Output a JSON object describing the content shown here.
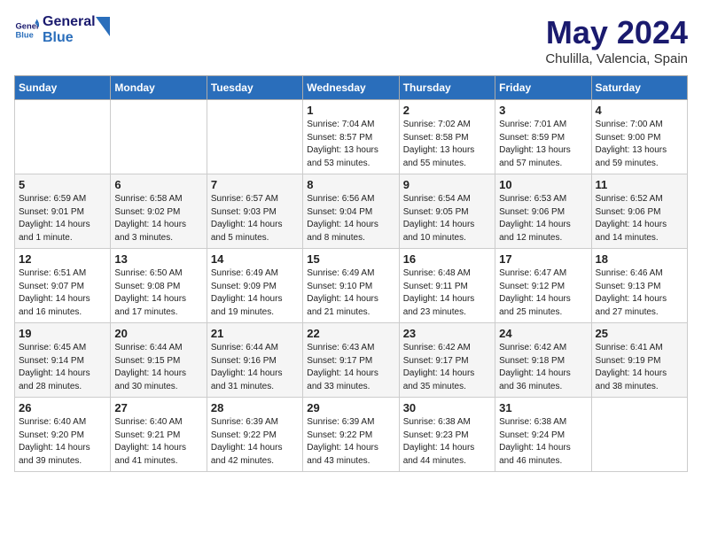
{
  "logo": {
    "line1": "General",
    "line2": "Blue"
  },
  "title": "May 2024",
  "subtitle": "Chulilla, Valencia, Spain",
  "days_of_week": [
    "Sunday",
    "Monday",
    "Tuesday",
    "Wednesday",
    "Thursday",
    "Friday",
    "Saturday"
  ],
  "weeks": [
    [
      {
        "num": "",
        "info": ""
      },
      {
        "num": "",
        "info": ""
      },
      {
        "num": "",
        "info": ""
      },
      {
        "num": "1",
        "info": "Sunrise: 7:04 AM\nSunset: 8:57 PM\nDaylight: 13 hours\nand 53 minutes."
      },
      {
        "num": "2",
        "info": "Sunrise: 7:02 AM\nSunset: 8:58 PM\nDaylight: 13 hours\nand 55 minutes."
      },
      {
        "num": "3",
        "info": "Sunrise: 7:01 AM\nSunset: 8:59 PM\nDaylight: 13 hours\nand 57 minutes."
      },
      {
        "num": "4",
        "info": "Sunrise: 7:00 AM\nSunset: 9:00 PM\nDaylight: 13 hours\nand 59 minutes."
      }
    ],
    [
      {
        "num": "5",
        "info": "Sunrise: 6:59 AM\nSunset: 9:01 PM\nDaylight: 14 hours\nand 1 minute."
      },
      {
        "num": "6",
        "info": "Sunrise: 6:58 AM\nSunset: 9:02 PM\nDaylight: 14 hours\nand 3 minutes."
      },
      {
        "num": "7",
        "info": "Sunrise: 6:57 AM\nSunset: 9:03 PM\nDaylight: 14 hours\nand 5 minutes."
      },
      {
        "num": "8",
        "info": "Sunrise: 6:56 AM\nSunset: 9:04 PM\nDaylight: 14 hours\nand 8 minutes."
      },
      {
        "num": "9",
        "info": "Sunrise: 6:54 AM\nSunset: 9:05 PM\nDaylight: 14 hours\nand 10 minutes."
      },
      {
        "num": "10",
        "info": "Sunrise: 6:53 AM\nSunset: 9:06 PM\nDaylight: 14 hours\nand 12 minutes."
      },
      {
        "num": "11",
        "info": "Sunrise: 6:52 AM\nSunset: 9:06 PM\nDaylight: 14 hours\nand 14 minutes."
      }
    ],
    [
      {
        "num": "12",
        "info": "Sunrise: 6:51 AM\nSunset: 9:07 PM\nDaylight: 14 hours\nand 16 minutes."
      },
      {
        "num": "13",
        "info": "Sunrise: 6:50 AM\nSunset: 9:08 PM\nDaylight: 14 hours\nand 17 minutes."
      },
      {
        "num": "14",
        "info": "Sunrise: 6:49 AM\nSunset: 9:09 PM\nDaylight: 14 hours\nand 19 minutes."
      },
      {
        "num": "15",
        "info": "Sunrise: 6:49 AM\nSunset: 9:10 PM\nDaylight: 14 hours\nand 21 minutes."
      },
      {
        "num": "16",
        "info": "Sunrise: 6:48 AM\nSunset: 9:11 PM\nDaylight: 14 hours\nand 23 minutes."
      },
      {
        "num": "17",
        "info": "Sunrise: 6:47 AM\nSunset: 9:12 PM\nDaylight: 14 hours\nand 25 minutes."
      },
      {
        "num": "18",
        "info": "Sunrise: 6:46 AM\nSunset: 9:13 PM\nDaylight: 14 hours\nand 27 minutes."
      }
    ],
    [
      {
        "num": "19",
        "info": "Sunrise: 6:45 AM\nSunset: 9:14 PM\nDaylight: 14 hours\nand 28 minutes."
      },
      {
        "num": "20",
        "info": "Sunrise: 6:44 AM\nSunset: 9:15 PM\nDaylight: 14 hours\nand 30 minutes."
      },
      {
        "num": "21",
        "info": "Sunrise: 6:44 AM\nSunset: 9:16 PM\nDaylight: 14 hours\nand 31 minutes."
      },
      {
        "num": "22",
        "info": "Sunrise: 6:43 AM\nSunset: 9:17 PM\nDaylight: 14 hours\nand 33 minutes."
      },
      {
        "num": "23",
        "info": "Sunrise: 6:42 AM\nSunset: 9:17 PM\nDaylight: 14 hours\nand 35 minutes."
      },
      {
        "num": "24",
        "info": "Sunrise: 6:42 AM\nSunset: 9:18 PM\nDaylight: 14 hours\nand 36 minutes."
      },
      {
        "num": "25",
        "info": "Sunrise: 6:41 AM\nSunset: 9:19 PM\nDaylight: 14 hours\nand 38 minutes."
      }
    ],
    [
      {
        "num": "26",
        "info": "Sunrise: 6:40 AM\nSunset: 9:20 PM\nDaylight: 14 hours\nand 39 minutes."
      },
      {
        "num": "27",
        "info": "Sunrise: 6:40 AM\nSunset: 9:21 PM\nDaylight: 14 hours\nand 41 minutes."
      },
      {
        "num": "28",
        "info": "Sunrise: 6:39 AM\nSunset: 9:22 PM\nDaylight: 14 hours\nand 42 minutes."
      },
      {
        "num": "29",
        "info": "Sunrise: 6:39 AM\nSunset: 9:22 PM\nDaylight: 14 hours\nand 43 minutes."
      },
      {
        "num": "30",
        "info": "Sunrise: 6:38 AM\nSunset: 9:23 PM\nDaylight: 14 hours\nand 44 minutes."
      },
      {
        "num": "31",
        "info": "Sunrise: 6:38 AM\nSunset: 9:24 PM\nDaylight: 14 hours\nand 46 minutes."
      },
      {
        "num": "",
        "info": ""
      }
    ]
  ]
}
